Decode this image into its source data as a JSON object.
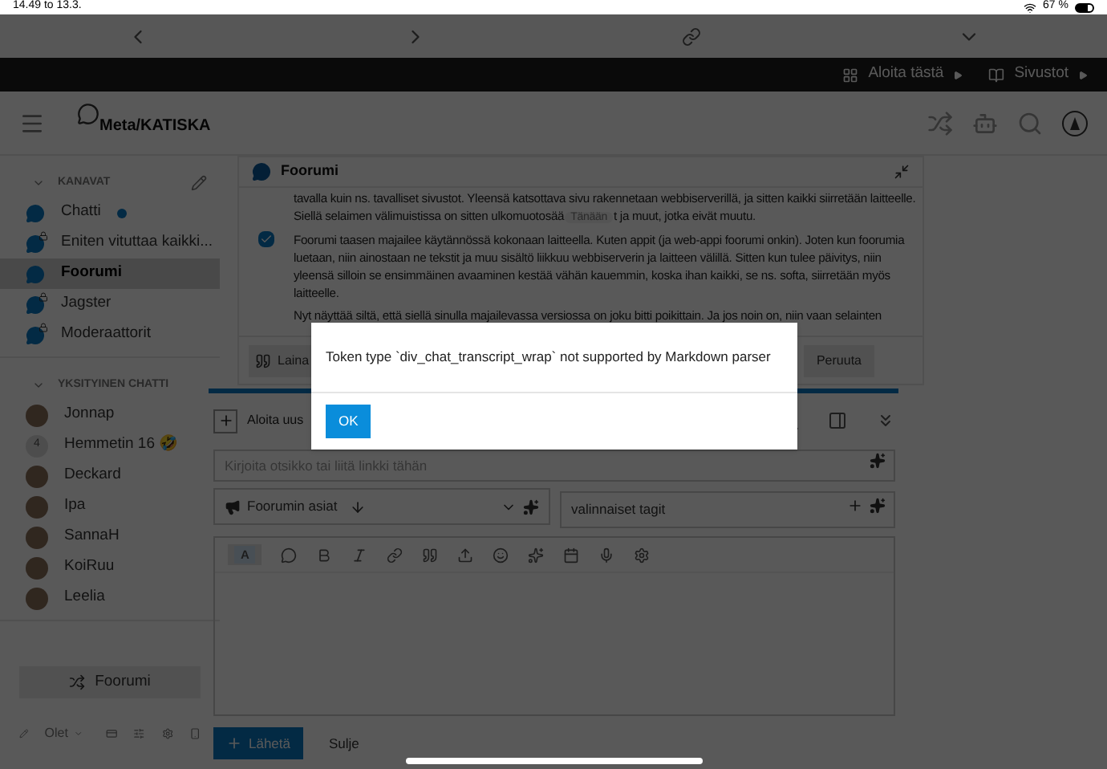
{
  "status_bar": {
    "time": "14.49",
    "date": "to 13.3.",
    "battery": "67 %"
  },
  "top_bar": {
    "links": [
      "Aloita tästä",
      "Sivustot"
    ]
  },
  "header": {
    "site": "Meta/KATISKA"
  },
  "sidebar": {
    "sections": [
      {
        "title": "KANAVAT",
        "expanded": true,
        "items": [
          {
            "name": "Chatti",
            "kind": "channel",
            "locked": false,
            "unread": true,
            "selected": false
          },
          {
            "name": "Eniten vituttaa kaikki...",
            "kind": "channel",
            "locked": true,
            "unread": false,
            "selected": false
          },
          {
            "name": "Foorumi",
            "kind": "channel",
            "locked": false,
            "unread": false,
            "selected": true
          },
          {
            "name": "Jagster",
            "kind": "channel",
            "locked": true,
            "unread": false,
            "selected": false
          },
          {
            "name": "Moderaattorit",
            "kind": "channel",
            "locked": true,
            "unread": false,
            "selected": false
          }
        ]
      },
      {
        "title": "YKSITYINEN CHATTI",
        "expanded": true,
        "items": [
          {
            "name": "Jonnap",
            "kind": "user",
            "unread": false,
            "selected": false
          },
          {
            "name": "Hemmetin 16 🤣",
            "kind": "group",
            "count": "4",
            "unread": false,
            "selected": false
          },
          {
            "name": "Deckard",
            "kind": "user",
            "unread": false,
            "selected": false
          },
          {
            "name": "Ipa",
            "kind": "user",
            "unread": false,
            "selected": false
          },
          {
            "name": "SannaH",
            "kind": "user",
            "unread": false,
            "selected": false
          },
          {
            "name": "KoiRuu",
            "kind": "user",
            "unread": false,
            "selected": false
          },
          {
            "name": "Leelia",
            "kind": "user",
            "unread": false,
            "selected": false
          }
        ]
      }
    ],
    "footer_button": "Foorumi",
    "status": "Olet"
  },
  "chat": {
    "title": "Foorumi",
    "checked": true,
    "paragraphs": [
      [
        "tavalla kuin ns. tavalliset sivustot. Yleensä katsottava sivu rakennetaan webbiserverillä, ja sitten kaikki siirretään laitteelle.",
        "Siellä selaimen välimuistissa on sitten ulkomuotosää",
        "Tänään",
        "t ja muut, jotka eivät muutu."
      ],
      [
        "Foorumi taasen majailee käytännössä kokonaan laitteella. Kuten appit (ja web-appi foorumi onkin). Joten kun foorumia luetaan, niin ainostaan ne tekstit ja muu sisältö liikkuu webbiserverin ja laitteen välillä. Sitten kun tulee päivitys, niin yleensä silloin se ensimmäinen avaaminen kestää vähän kauemmin, koska ihan kaikki, se ns. softa, siirretään myös laitteelle."
      ],
      [
        "Nyt näyttää siltä, että siellä sinulla majailevassa versiossa on joku bitti poikittain. Ja jos noin on, niin vaan selainten"
      ]
    ],
    "actions": [
      "Laina",
      "Peruuta"
    ]
  },
  "composer": {
    "new_topic": "Aloita uus",
    "title_placeholder": "Kirjoita otsikko tai liitä linkki tähän",
    "category": "Foorumin asiat",
    "tags_placeholder": "valinnaiset tagit",
    "submit": "Lähetä",
    "close": "Sulje",
    "mode": "A"
  },
  "dialog": {
    "message": "Token type `div_chat_transcript_wrap` not supported by Markdown parser",
    "button": "OK"
  }
}
